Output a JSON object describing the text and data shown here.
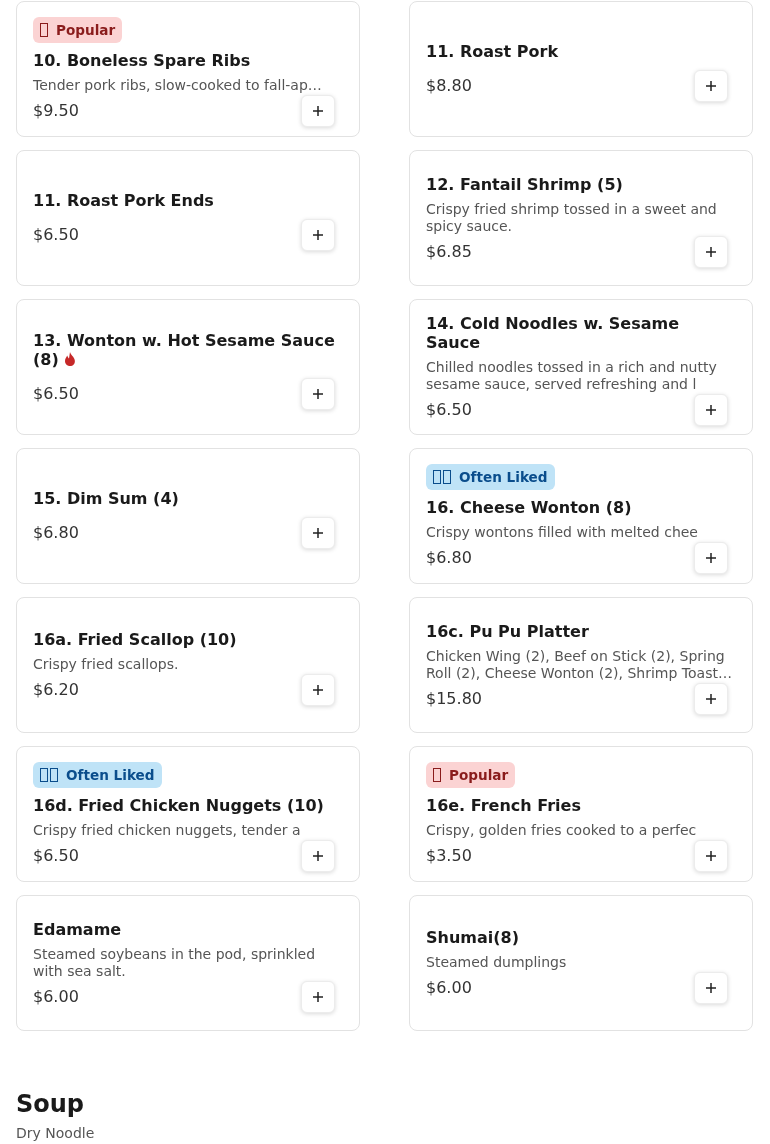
{
  "rows": [
    {
      "items": [
        {
          "name": "10. Boneless Spare Ribs",
          "description": "Tender pork ribs, slow-cooked to fall-ap…",
          "price": "$9.50",
          "badge": {
            "kind": "popular",
            "label": "Popular"
          },
          "spicy": false
        },
        {
          "name": "11. Roast Pork",
          "price": "$8.80",
          "spicy": false
        }
      ]
    },
    {
      "items": [
        {
          "name": "11. Roast Pork Ends",
          "price": "$6.50",
          "spicy": false
        },
        {
          "name": "12. Fantail Shrimp (5)",
          "description": "Crispy fried shrimp tossed in a sweet and spicy sauce.",
          "price": "$6.85",
          "spicy": false
        }
      ]
    },
    {
      "items": [
        {
          "name": "13. Wonton w. Hot Sesame Sauce (8)",
          "price": "$6.50",
          "spicy": true
        },
        {
          "name": "14. Cold Noodles w. Sesame Sauce",
          "description": "Chilled noodles tossed in a rich and nutty sesame sauce, served refreshing and l",
          "price": "$6.50",
          "spicy": false
        }
      ]
    },
    {
      "items": [
        {
          "name": "15. Dim Sum (4)",
          "price": "$6.80",
          "spicy": false
        },
        {
          "name": "16. Cheese Wonton (8)",
          "description": "Crispy wontons filled with melted chee",
          "price": "$6.80",
          "badge": {
            "kind": "often_liked",
            "label": "Often Liked"
          },
          "spicy": false
        }
      ]
    },
    {
      "items": [
        {
          "name": "16a. Fried Scallop (10)",
          "description": "Crispy fried scallops.",
          "price": "$6.20",
          "spicy": false
        },
        {
          "name": "16c. Pu Pu Platter",
          "description": "Chicken Wing (2), Beef on Stick (2), Spring Roll (2), Cheese Wonton (2), Shrimp Toast…",
          "price": "$15.80",
          "spicy": false
        }
      ]
    },
    {
      "items": [
        {
          "name": "16d. Fried Chicken Nuggets (10)",
          "description": "Crispy fried chicken nuggets, tender a",
          "price": "$6.50",
          "badge": {
            "kind": "often_liked",
            "label": "Often Liked"
          },
          "spicy": false
        },
        {
          "name": "16e. French Fries",
          "description": "Crispy, golden fries cooked to a perfec",
          "price": "$3.50",
          "badge": {
            "kind": "popular",
            "label": "Popular"
          },
          "spicy": false
        }
      ]
    },
    {
      "items": [
        {
          "name": "Edamame",
          "description": "Steamed soybeans in the pod, sprinkled with sea salt.",
          "price": "$6.00",
          "spicy": false
        },
        {
          "name": "Shumai(8)",
          "description": "Steamed dumplings",
          "price": "$6.00",
          "spicy": false
        }
      ]
    }
  ],
  "next_section": {
    "title": "Soup",
    "subtitle": "Dry Noodle"
  }
}
